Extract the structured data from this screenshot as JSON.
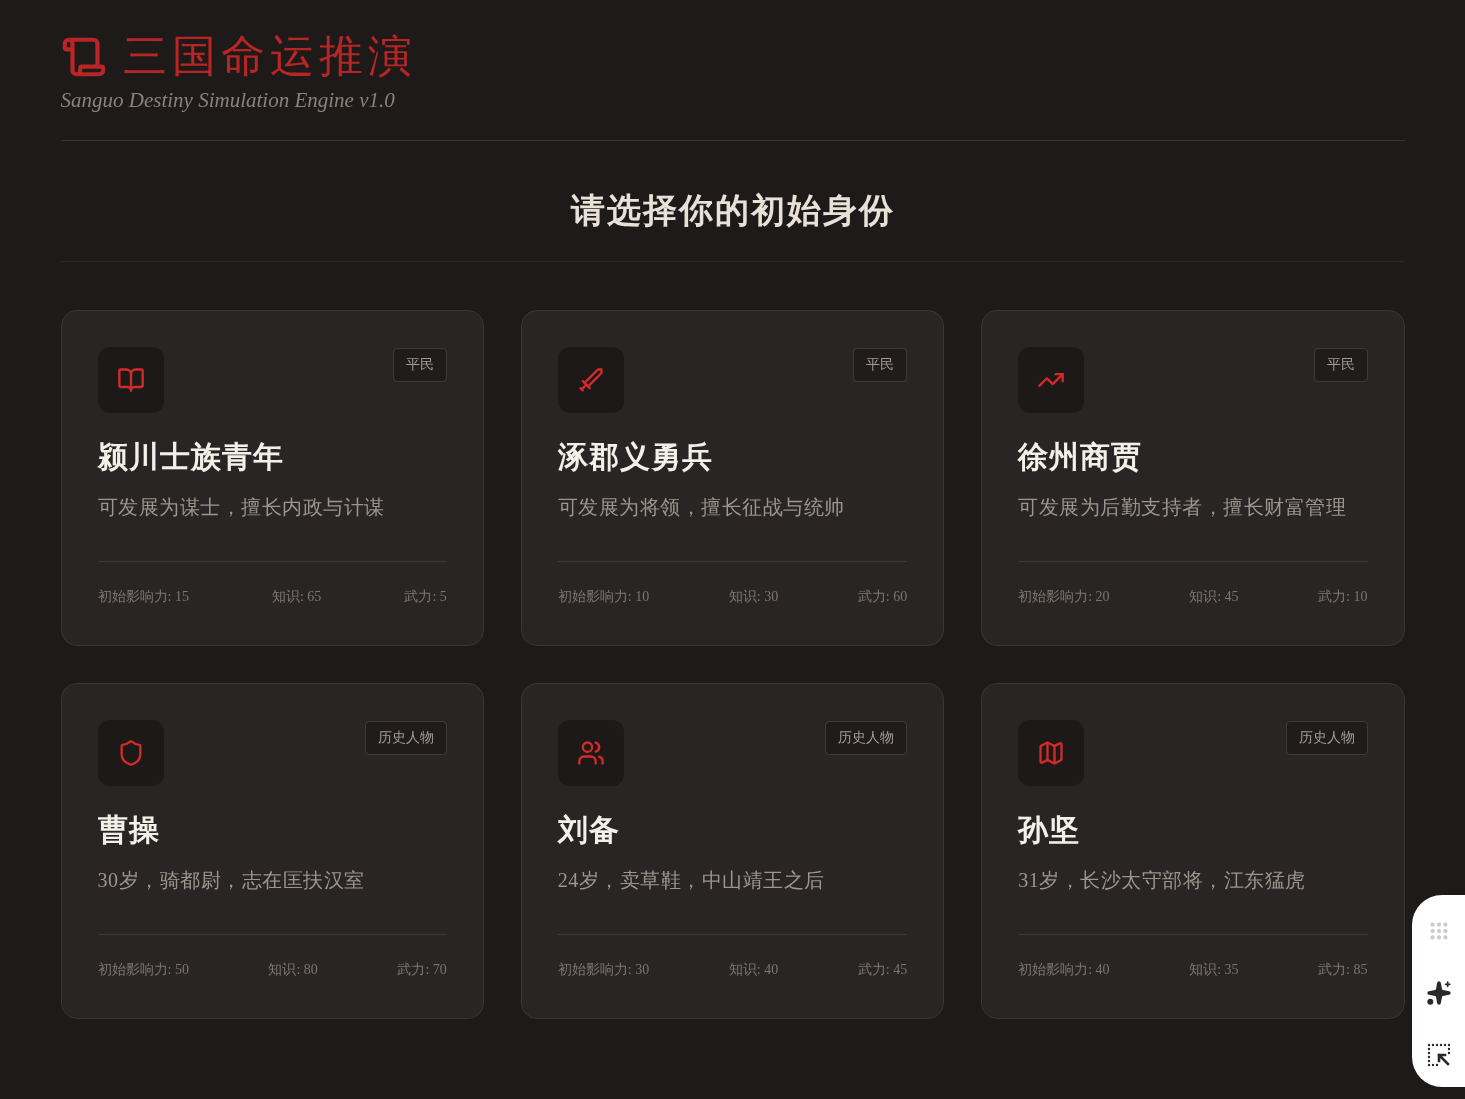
{
  "header": {
    "title": "三国命运推演",
    "subtitle": "Sanguo Destiny Simulation Engine v1.0"
  },
  "heading": "请选择你的初始身份",
  "cards": [
    {
      "tag": "平民",
      "name": "颍川士族青年",
      "description": "可发展为谋士，擅长内政与计谋",
      "stats": [
        "初始影响力: 15",
        "知识: 65",
        "武力: 5"
      ]
    },
    {
      "tag": "平民",
      "name": "涿郡义勇兵",
      "description": "可发展为将领，擅长征战与统帅",
      "stats": [
        "初始影响力: 10",
        "知识: 30",
        "武力: 60"
      ]
    },
    {
      "tag": "平民",
      "name": "徐州商贾",
      "description": "可发展为后勤支持者，擅长财富管理",
      "stats": [
        "初始影响力: 20",
        "知识: 45",
        "武力: 10"
      ]
    },
    {
      "tag": "历史人物",
      "name": "曹操",
      "description": "30岁，骑都尉，志在匡扶汉室",
      "stats": [
        "初始影响力: 50",
        "知识: 80",
        "武力: 70"
      ]
    },
    {
      "tag": "历史人物",
      "name": "刘备",
      "description": "24岁，卖草鞋，中山靖王之后",
      "stats": [
        "初始影响力: 30",
        "知识: 40",
        "武力: 45"
      ]
    },
    {
      "tag": "历史人物",
      "name": "孙坚",
      "description": "31岁，长沙太守部将，江东猛虎",
      "stats": [
        "初始影响力: 40",
        "知识: 35",
        "武力: 85"
      ]
    }
  ]
}
